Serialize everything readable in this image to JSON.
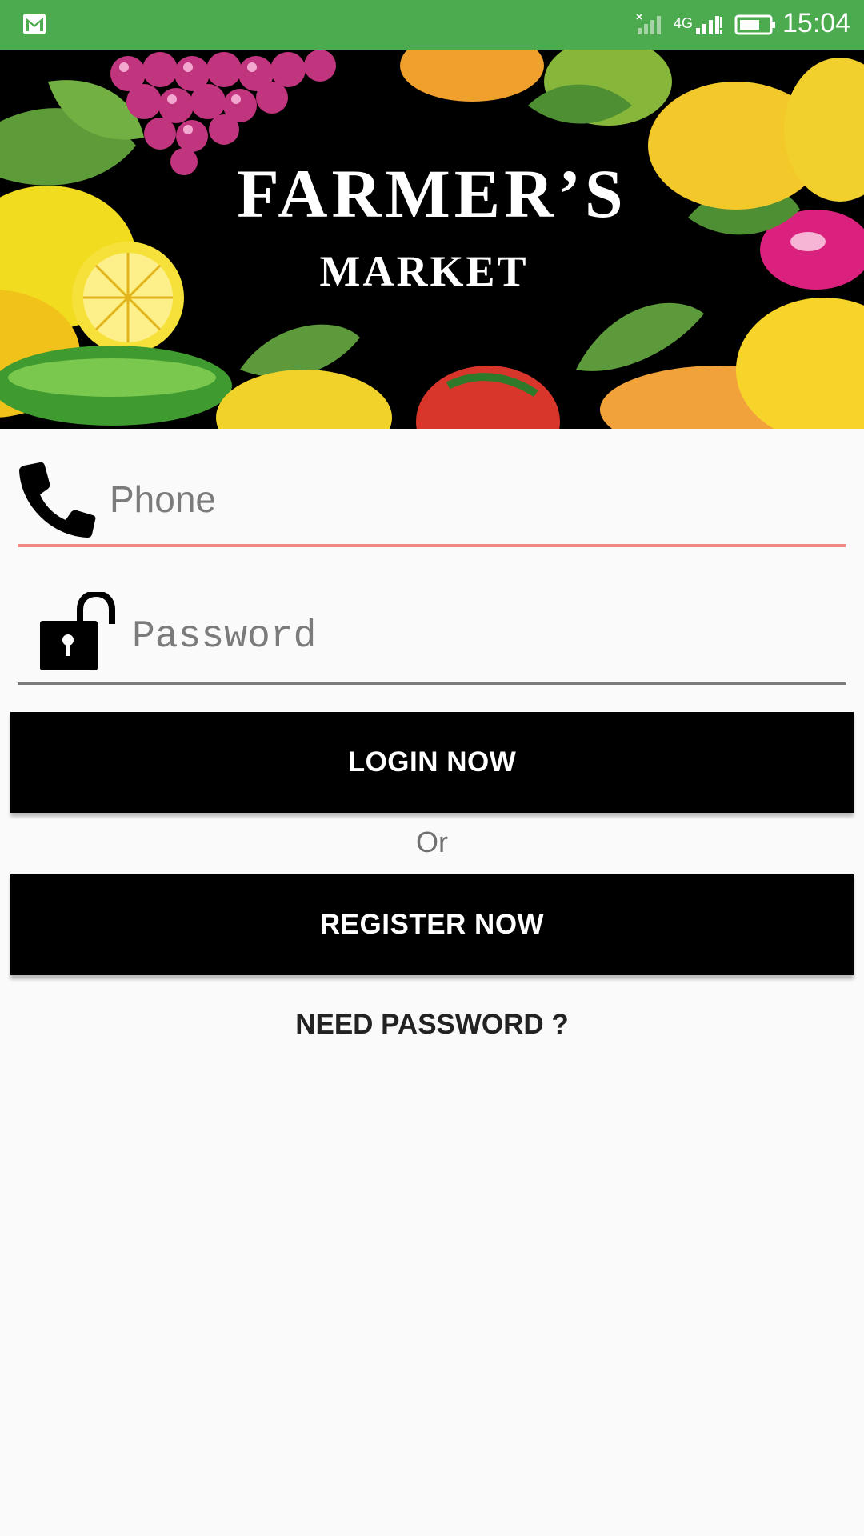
{
  "status_bar": {
    "network_type": "4G",
    "time": "15:04",
    "icons": [
      "gmail-icon",
      "sim-off-icon",
      "signal-icon",
      "battery-icon"
    ],
    "color": "#4caa4f"
  },
  "banner": {
    "title": "FARMER’S",
    "subtitle": "MARKET"
  },
  "form": {
    "phone_placeholder": "Phone",
    "password_placeholder": "Password",
    "phone_value": "",
    "password_value": "",
    "phone_underline_color": "#ef8b82",
    "password_underline_color": "#7a7a7a"
  },
  "actions": {
    "login_label": "LOGIN NOW",
    "or_label": "Or",
    "register_label": "REGISTER NOW",
    "need_password_label": "NEED PASSWORD ?"
  }
}
